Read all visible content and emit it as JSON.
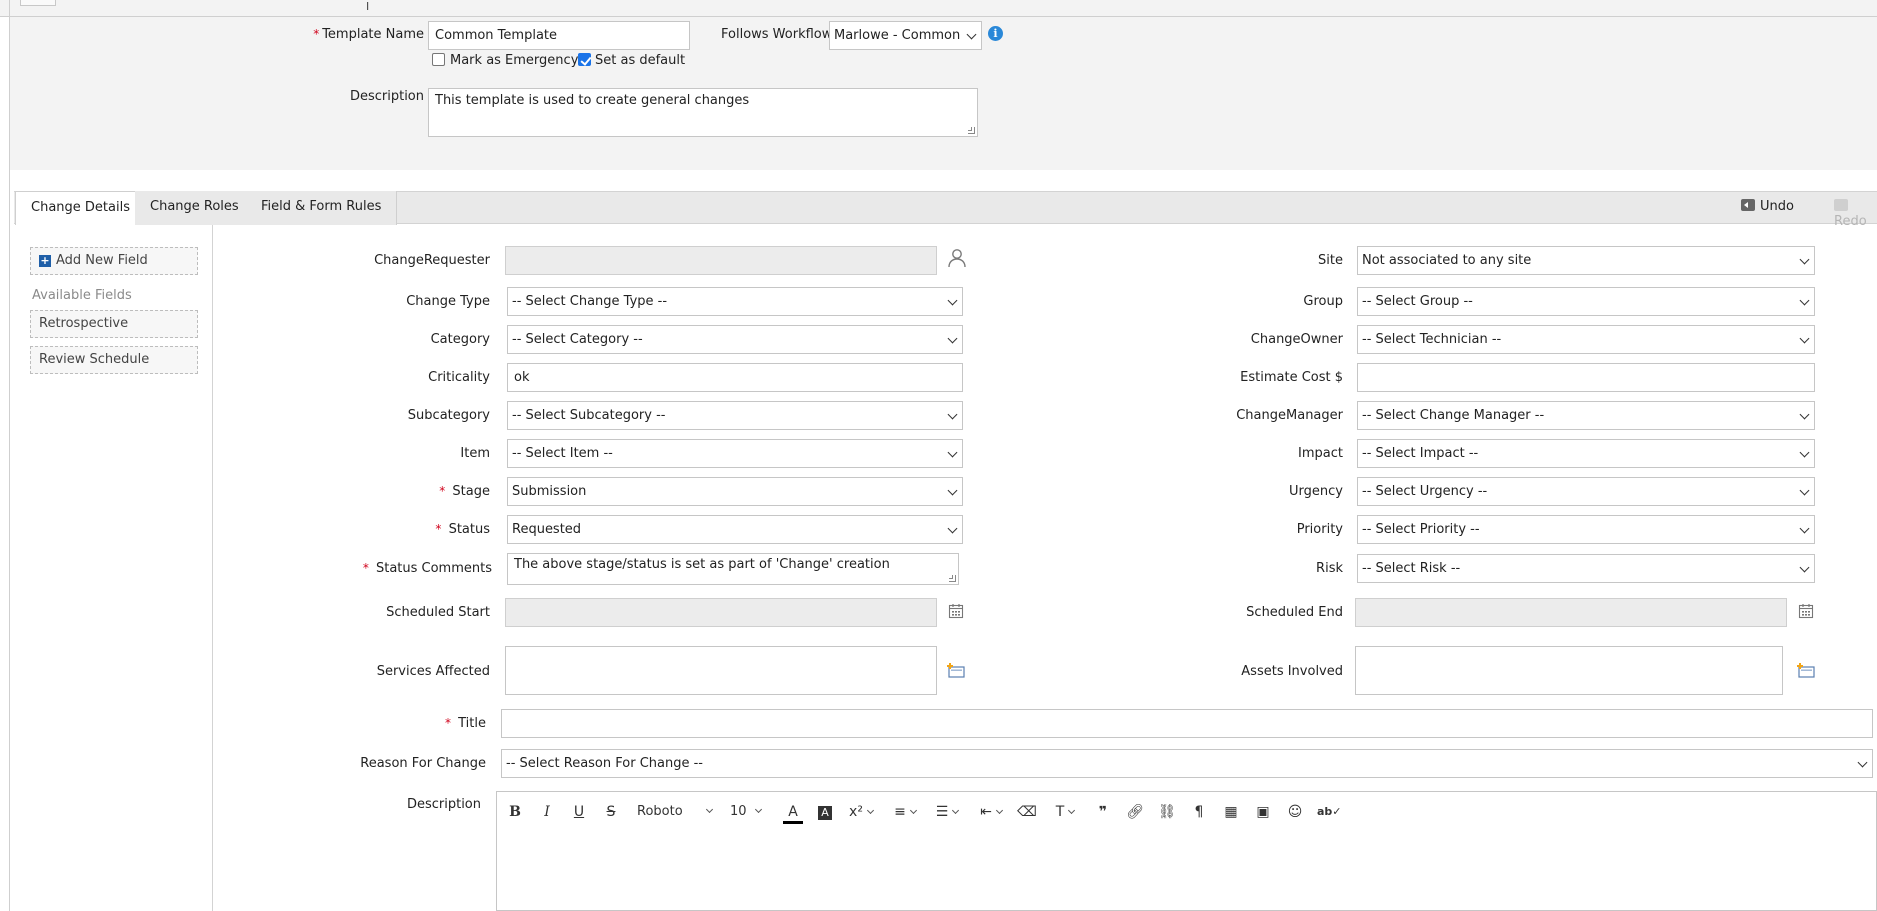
{
  "header": {
    "template_name_label": "Template Name",
    "template_name_value": "Common Template",
    "follows_workflow_label": "Follows Workflow",
    "follows_workflow_value": "Marlowe - Common",
    "mark_emergency_label": "Mark as Emergency",
    "mark_emergency_checked": false,
    "set_default_label": "Set as default",
    "set_default_checked": true,
    "description_label": "Description",
    "description_value": "This template is used to create general changes"
  },
  "tabs": [
    {
      "label": "Change Details",
      "active": true
    },
    {
      "label": "Change Roles",
      "active": false
    },
    {
      "label": "Field & Form Rules",
      "active": false
    }
  ],
  "toolbar": {
    "undo_label": "Undo",
    "redo_label": "Redo"
  },
  "sidebar": {
    "add_field_label": "Add New Field",
    "available_title": "Available Fields",
    "items": [
      "Retrospective",
      "Review Schedule"
    ]
  },
  "form": {
    "change_requester": {
      "label": "ChangeRequester",
      "value": ""
    },
    "change_type": {
      "label": "Change Type",
      "value": "-- Select Change Type --"
    },
    "category": {
      "label": "Category",
      "value": "-- Select Category --"
    },
    "criticality": {
      "label": "Criticality",
      "value": "ok"
    },
    "subcategory": {
      "label": "Subcategory",
      "value": "-- Select Subcategory --"
    },
    "item": {
      "label": "Item",
      "value": "-- Select Item --"
    },
    "stage": {
      "label": "Stage",
      "value": "Submission"
    },
    "status": {
      "label": "Status",
      "value": "Requested"
    },
    "status_comments": {
      "label": "Status Comments",
      "value": "The above stage/status is set as part of 'Change' creation"
    },
    "scheduled_start": {
      "label": "Scheduled Start",
      "value": ""
    },
    "services_affected": {
      "label": "Services Affected",
      "value": ""
    },
    "site": {
      "label": "Site",
      "value": "Not associated to any site"
    },
    "group": {
      "label": "Group",
      "value": "-- Select Group --"
    },
    "change_owner": {
      "label": "ChangeOwner",
      "value": "-- Select Technician --"
    },
    "estimate_cost": {
      "label": "Estimate Cost $",
      "value": ""
    },
    "change_manager": {
      "label": "ChangeManager",
      "value": "-- Select Change Manager --"
    },
    "impact": {
      "label": "Impact",
      "value": "-- Select Impact --"
    },
    "urgency": {
      "label": "Urgency",
      "value": "-- Select Urgency --"
    },
    "priority": {
      "label": "Priority",
      "value": "-- Select Priority --"
    },
    "risk": {
      "label": "Risk",
      "value": "-- Select Risk --"
    },
    "scheduled_end": {
      "label": "Scheduled End",
      "value": ""
    },
    "assets_involved": {
      "label": "Assets Involved",
      "value": ""
    },
    "title": {
      "label": "Title",
      "value": ""
    },
    "reason_for_change": {
      "label": "Reason For Change",
      "value": "-- Select Reason For Change --"
    },
    "description": {
      "label": "Description"
    }
  },
  "editor": {
    "font_family": "Roboto",
    "font_size": "10",
    "buttons": [
      "bold",
      "italic",
      "underline",
      "strikethrough",
      "font-family",
      "font-size",
      "text-color",
      "highlight",
      "superscript",
      "align",
      "bulleted-list",
      "indent",
      "clear-format",
      "text-direction",
      "quote",
      "link",
      "unlink",
      "paragraph",
      "table",
      "image",
      "emoji",
      "spellcheck"
    ]
  }
}
